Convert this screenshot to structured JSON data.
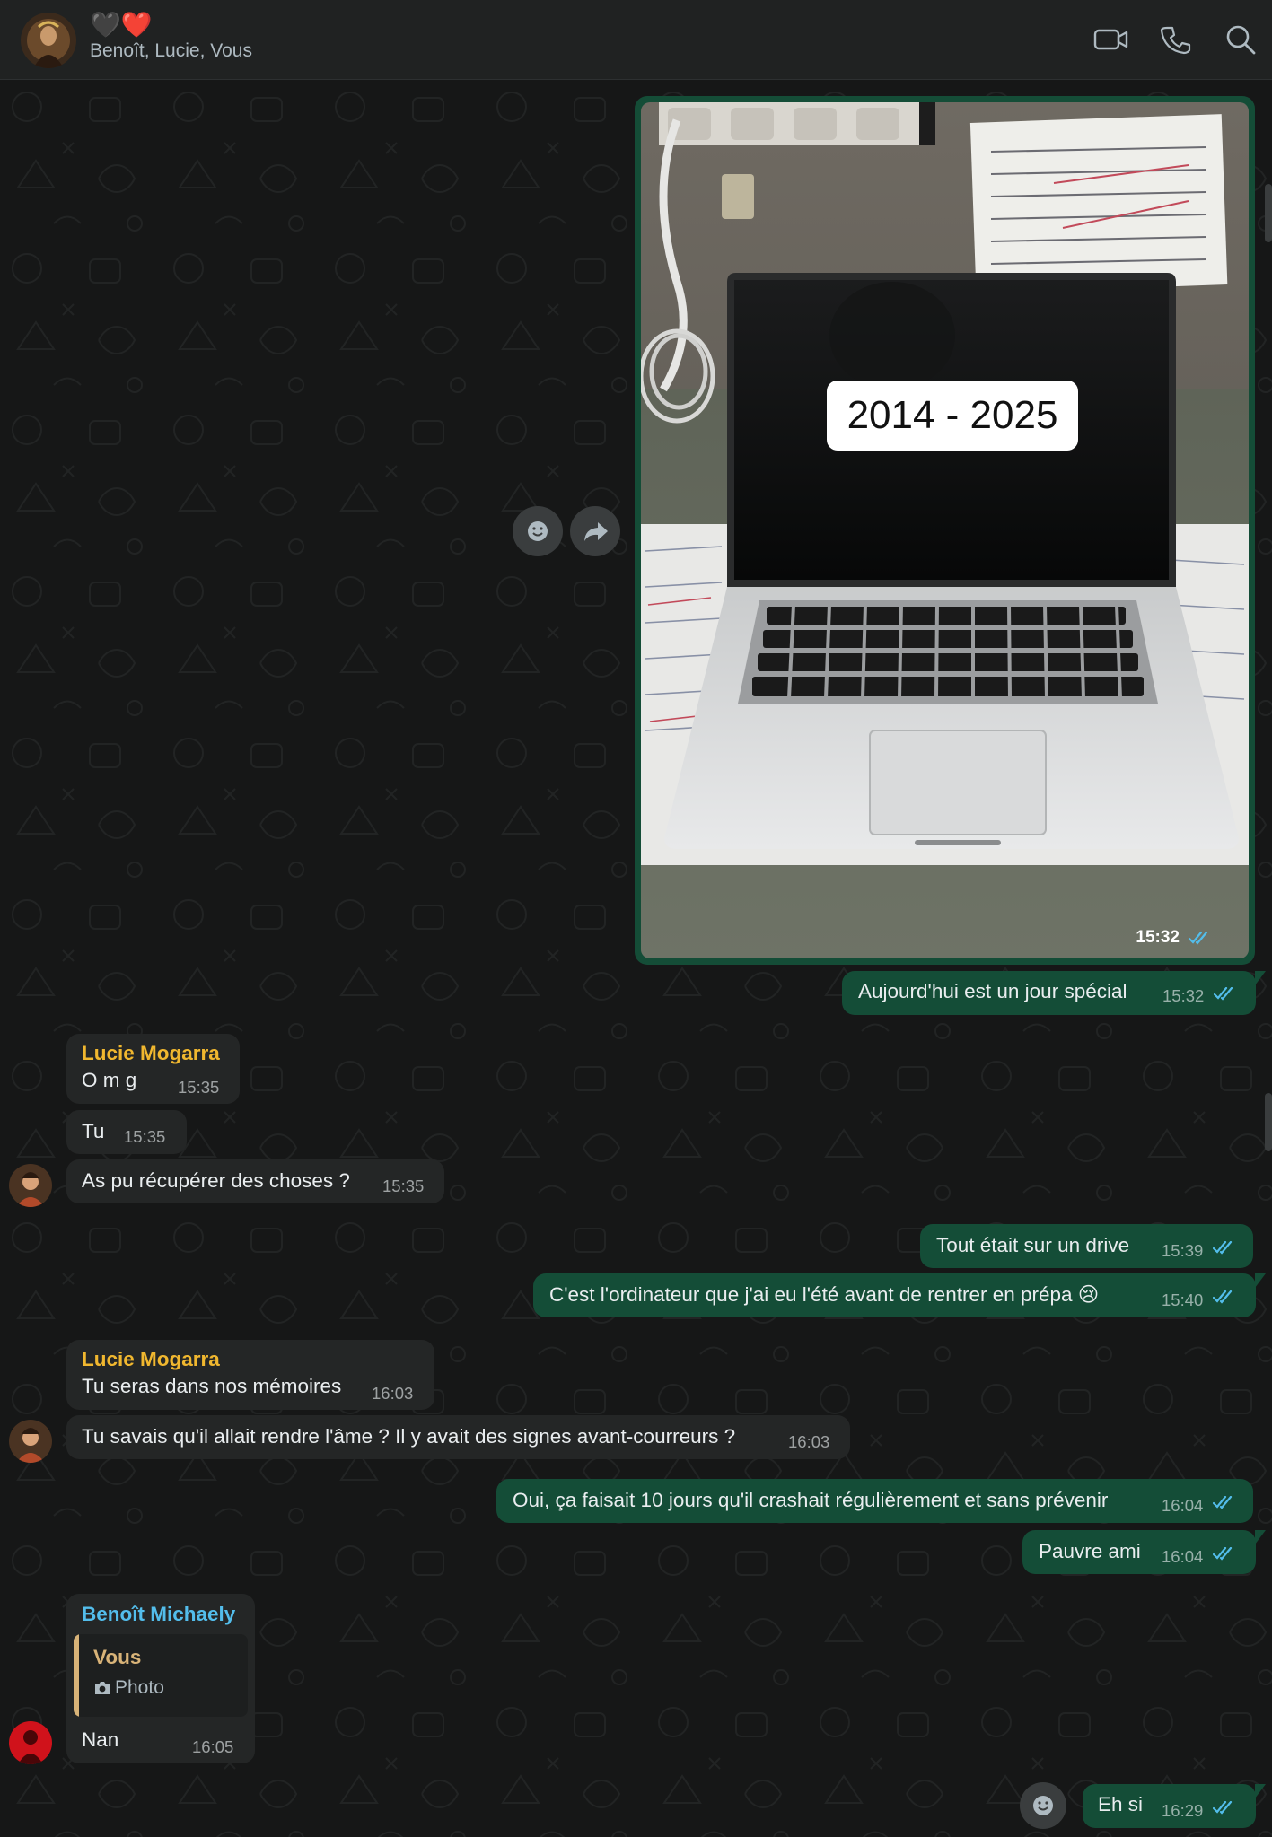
{
  "header": {
    "title_emoji": "🖤❤️",
    "participants": "Benoît, Lucie, Vous",
    "icons": [
      "video-call-icon",
      "voice-call-icon",
      "search-icon"
    ]
  },
  "photo_message": {
    "overlay_text": "2014 - 2025",
    "time": "15:32",
    "status": "read"
  },
  "messages": [
    {
      "dir": "out",
      "text": "Aujourd'hui est un jour spécial",
      "time": "15:32"
    },
    {
      "dir": "in",
      "sender": "Lucie Mogarra",
      "text": "O m g",
      "time": "15:35"
    },
    {
      "dir": "in",
      "text": "Tu",
      "time": "15:35"
    },
    {
      "dir": "in",
      "text": "As pu récupérer des choses ?",
      "time": "15:35"
    },
    {
      "dir": "out",
      "text": "Tout était sur un drive",
      "time": "15:39"
    },
    {
      "dir": "out",
      "text": "C'est l'ordinateur que j'ai eu l'été avant de rentrer en prépa 😢",
      "time": "15:40"
    },
    {
      "dir": "in",
      "sender": "Lucie Mogarra",
      "text": "Tu seras dans nos mémoires",
      "time": "16:03"
    },
    {
      "dir": "in",
      "text": "Tu savais qu'il allait rendre l'âme ? Il y avait des signes avant-courreurs ?",
      "time": "16:03"
    },
    {
      "dir": "out",
      "text": "Oui, ça faisait 10 jours qu'il crashait régulièrement et sans prévenir",
      "time": "16:04"
    },
    {
      "dir": "out",
      "text": "Pauvre ami",
      "time": "16:04"
    },
    {
      "dir": "in",
      "sender": "Benoît Michaely",
      "reply_author": "Vous",
      "reply_type": "Photo",
      "text": "Nan",
      "time": "16:05"
    },
    {
      "dir": "out",
      "text": "Eh si",
      "time": "16:29"
    }
  ],
  "colors": {
    "background": "#161717",
    "header": "#202222",
    "incoming_bubble": "#242626",
    "outgoing_bubble": "#144d37",
    "lucie_name": "#f0b72f",
    "benoit_name": "#53bdeb",
    "read_ticks": "#53bdeb"
  }
}
